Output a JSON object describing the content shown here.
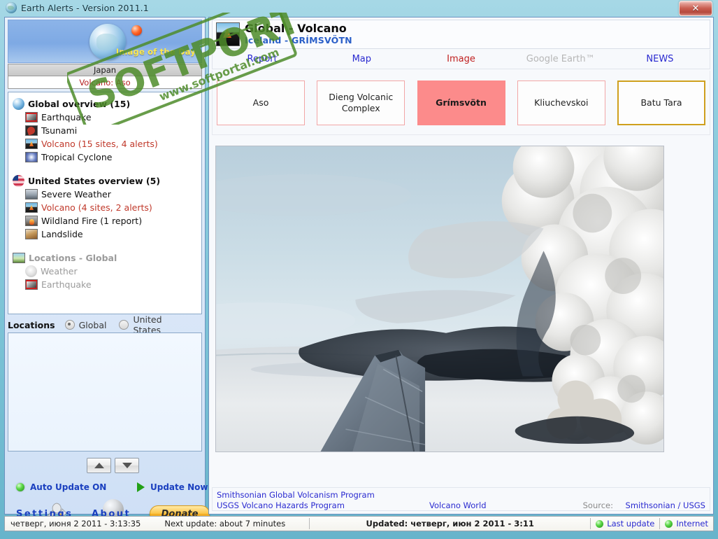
{
  "window": {
    "title": "Earth Alerts - Version 2011.1",
    "title_icon": "globe-icon",
    "close_label": "✕"
  },
  "sidebar": {
    "image_of_the_day": {
      "label": "Image of the Day",
      "country": "Japan",
      "event": "Volcano: Aso"
    },
    "tree": [
      {
        "label": "Global overview (15)",
        "icon": "globe-icon",
        "state": "normal",
        "children": [
          {
            "label": "Earthquake",
            "icon": "earthquake-icon",
            "state": "normal"
          },
          {
            "label": "Tsunami",
            "icon": "tsunami-icon",
            "state": "normal"
          },
          {
            "label": "Volcano (15 sites, 4 alerts)",
            "icon": "volcano-icon",
            "state": "alert"
          },
          {
            "label": "Tropical Cyclone",
            "icon": "cyclone-icon",
            "state": "normal"
          }
        ]
      },
      {
        "label": "United States overview (5)",
        "icon": "usa-flag-icon",
        "state": "normal",
        "children": [
          {
            "label": "Severe Weather",
            "icon": "severe-weather-icon",
            "state": "normal"
          },
          {
            "label": "Volcano (4 sites, 2 alerts)",
            "icon": "volcano-icon",
            "state": "alert"
          },
          {
            "label": "Wildland Fire (1 report)",
            "icon": "wildfire-icon",
            "state": "normal"
          },
          {
            "label": "Landslide",
            "icon": "landslide-icon",
            "state": "normal"
          }
        ]
      },
      {
        "label": "Locations - Global",
        "icon": "locations-icon",
        "state": "dim",
        "children": [
          {
            "label": "Weather",
            "icon": "weather-icon",
            "state": "dim"
          },
          {
            "label": "Earthquake",
            "icon": "earthquake-icon",
            "state": "dim"
          }
        ]
      }
    ],
    "locations": {
      "title": "Locations",
      "options": [
        {
          "label": "Global",
          "selected": true
        },
        {
          "label": "United States",
          "selected": false
        }
      ],
      "items": []
    },
    "scroll_up": "▲",
    "scroll_down": "▼",
    "auto_update": "Auto Update ON",
    "update_now": "Update Now",
    "settings": "Settings",
    "about": "About",
    "donate": "Donate"
  },
  "main": {
    "header": {
      "title": "Global - Volcano",
      "subtitle": "Iceland - GRÍMSVÖTN",
      "thumb_icon": "volcano-thumb-icon"
    },
    "nav_tabs": [
      {
        "label": "Report",
        "style": "blue"
      },
      {
        "label": "Map",
        "style": "blue"
      },
      {
        "label": "Image",
        "style": "active"
      },
      {
        "label": "Google Earth™",
        "style": "disabled"
      },
      {
        "label": "NEWS",
        "style": "blue"
      }
    ],
    "site_tabs": [
      {
        "label": "Aso",
        "style": "normal"
      },
      {
        "label": "Dieng Volcanic Complex",
        "style": "normal"
      },
      {
        "label": "Grímsvötn",
        "style": "selected"
      },
      {
        "label": "Kliuchevskoi",
        "style": "normal"
      },
      {
        "label": "Batu Tara",
        "style": "gold"
      }
    ],
    "photo_alt": "Aerial photo of Grímsvötn eruption ash plume over glacier seen past an aircraft wing",
    "footer": {
      "link1": "Smithsonian Global Volcanism Program",
      "link2": "USGS Volcano Hazards Program",
      "link3": "Volcano World",
      "source_label": "Source:",
      "source_link": "Smithsonian / USGS"
    }
  },
  "statusbar": {
    "date": "четверг, июня 2 2011 - 3:13:35",
    "next_update": "Next update: about 7 minutes",
    "updated": "Updated: четверг, июн 2 2011 - 3:11",
    "indicators": [
      {
        "label": "Last update",
        "state": "ok"
      },
      {
        "label": "Internet",
        "state": "ok"
      }
    ]
  },
  "watermark": {
    "text": "SOFTPORTAL",
    "url": "www.softportal.com",
    "color": "#4e8c2a"
  },
  "colors": {
    "titlebar": "#8fcede",
    "accent_link": "#2a2ad0",
    "alert": "#c0392b",
    "selected_tab": "#fc8b8b",
    "gold_border": "#cfa01e",
    "led_green": "#5ed84a"
  }
}
